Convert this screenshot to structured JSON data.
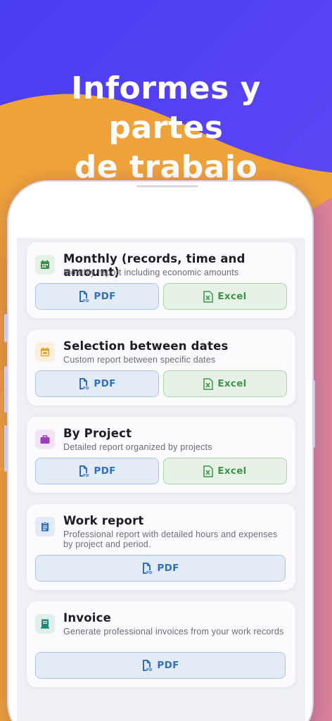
{
  "headline": {
    "line1": "Informes y partes",
    "line2": "de trabajo"
  },
  "colors": {
    "background_blue": "#5a46f5",
    "wave_orange": "#f0a23a",
    "pdf_accent": "#2f6fc0",
    "excel_accent": "#3e9349"
  },
  "reports": [
    {
      "title": "Monthly (records, time and amount)",
      "description": "Monthly report including economic amounts",
      "icon": "calendar-month-icon",
      "icon_color": "#3e9349",
      "pdf_label": "PDF",
      "excel_label": "Excel"
    },
    {
      "title": "Selection between dates",
      "description": "Custom report between specific dates",
      "icon": "calendar-range-icon",
      "icon_color": "#e6a12a",
      "pdf_label": "PDF",
      "excel_label": "Excel"
    },
    {
      "title": "By Project",
      "description": "Detailed report organized by projects",
      "icon": "briefcase-icon",
      "icon_color": "#9b3cb8",
      "pdf_label": "PDF",
      "excel_label": "Excel"
    },
    {
      "title": "Work report",
      "description": "Professional report with detailed hours and expenses by project and period.",
      "icon": "clipboard-icon",
      "icon_color": "#2f6fc0",
      "pdf_label": "PDF"
    },
    {
      "title": "Invoice",
      "description": "Generate professional invoices from your work records",
      "icon": "invoice-icon",
      "icon_color": "#1f8a7a",
      "pdf_label": "PDF"
    }
  ]
}
